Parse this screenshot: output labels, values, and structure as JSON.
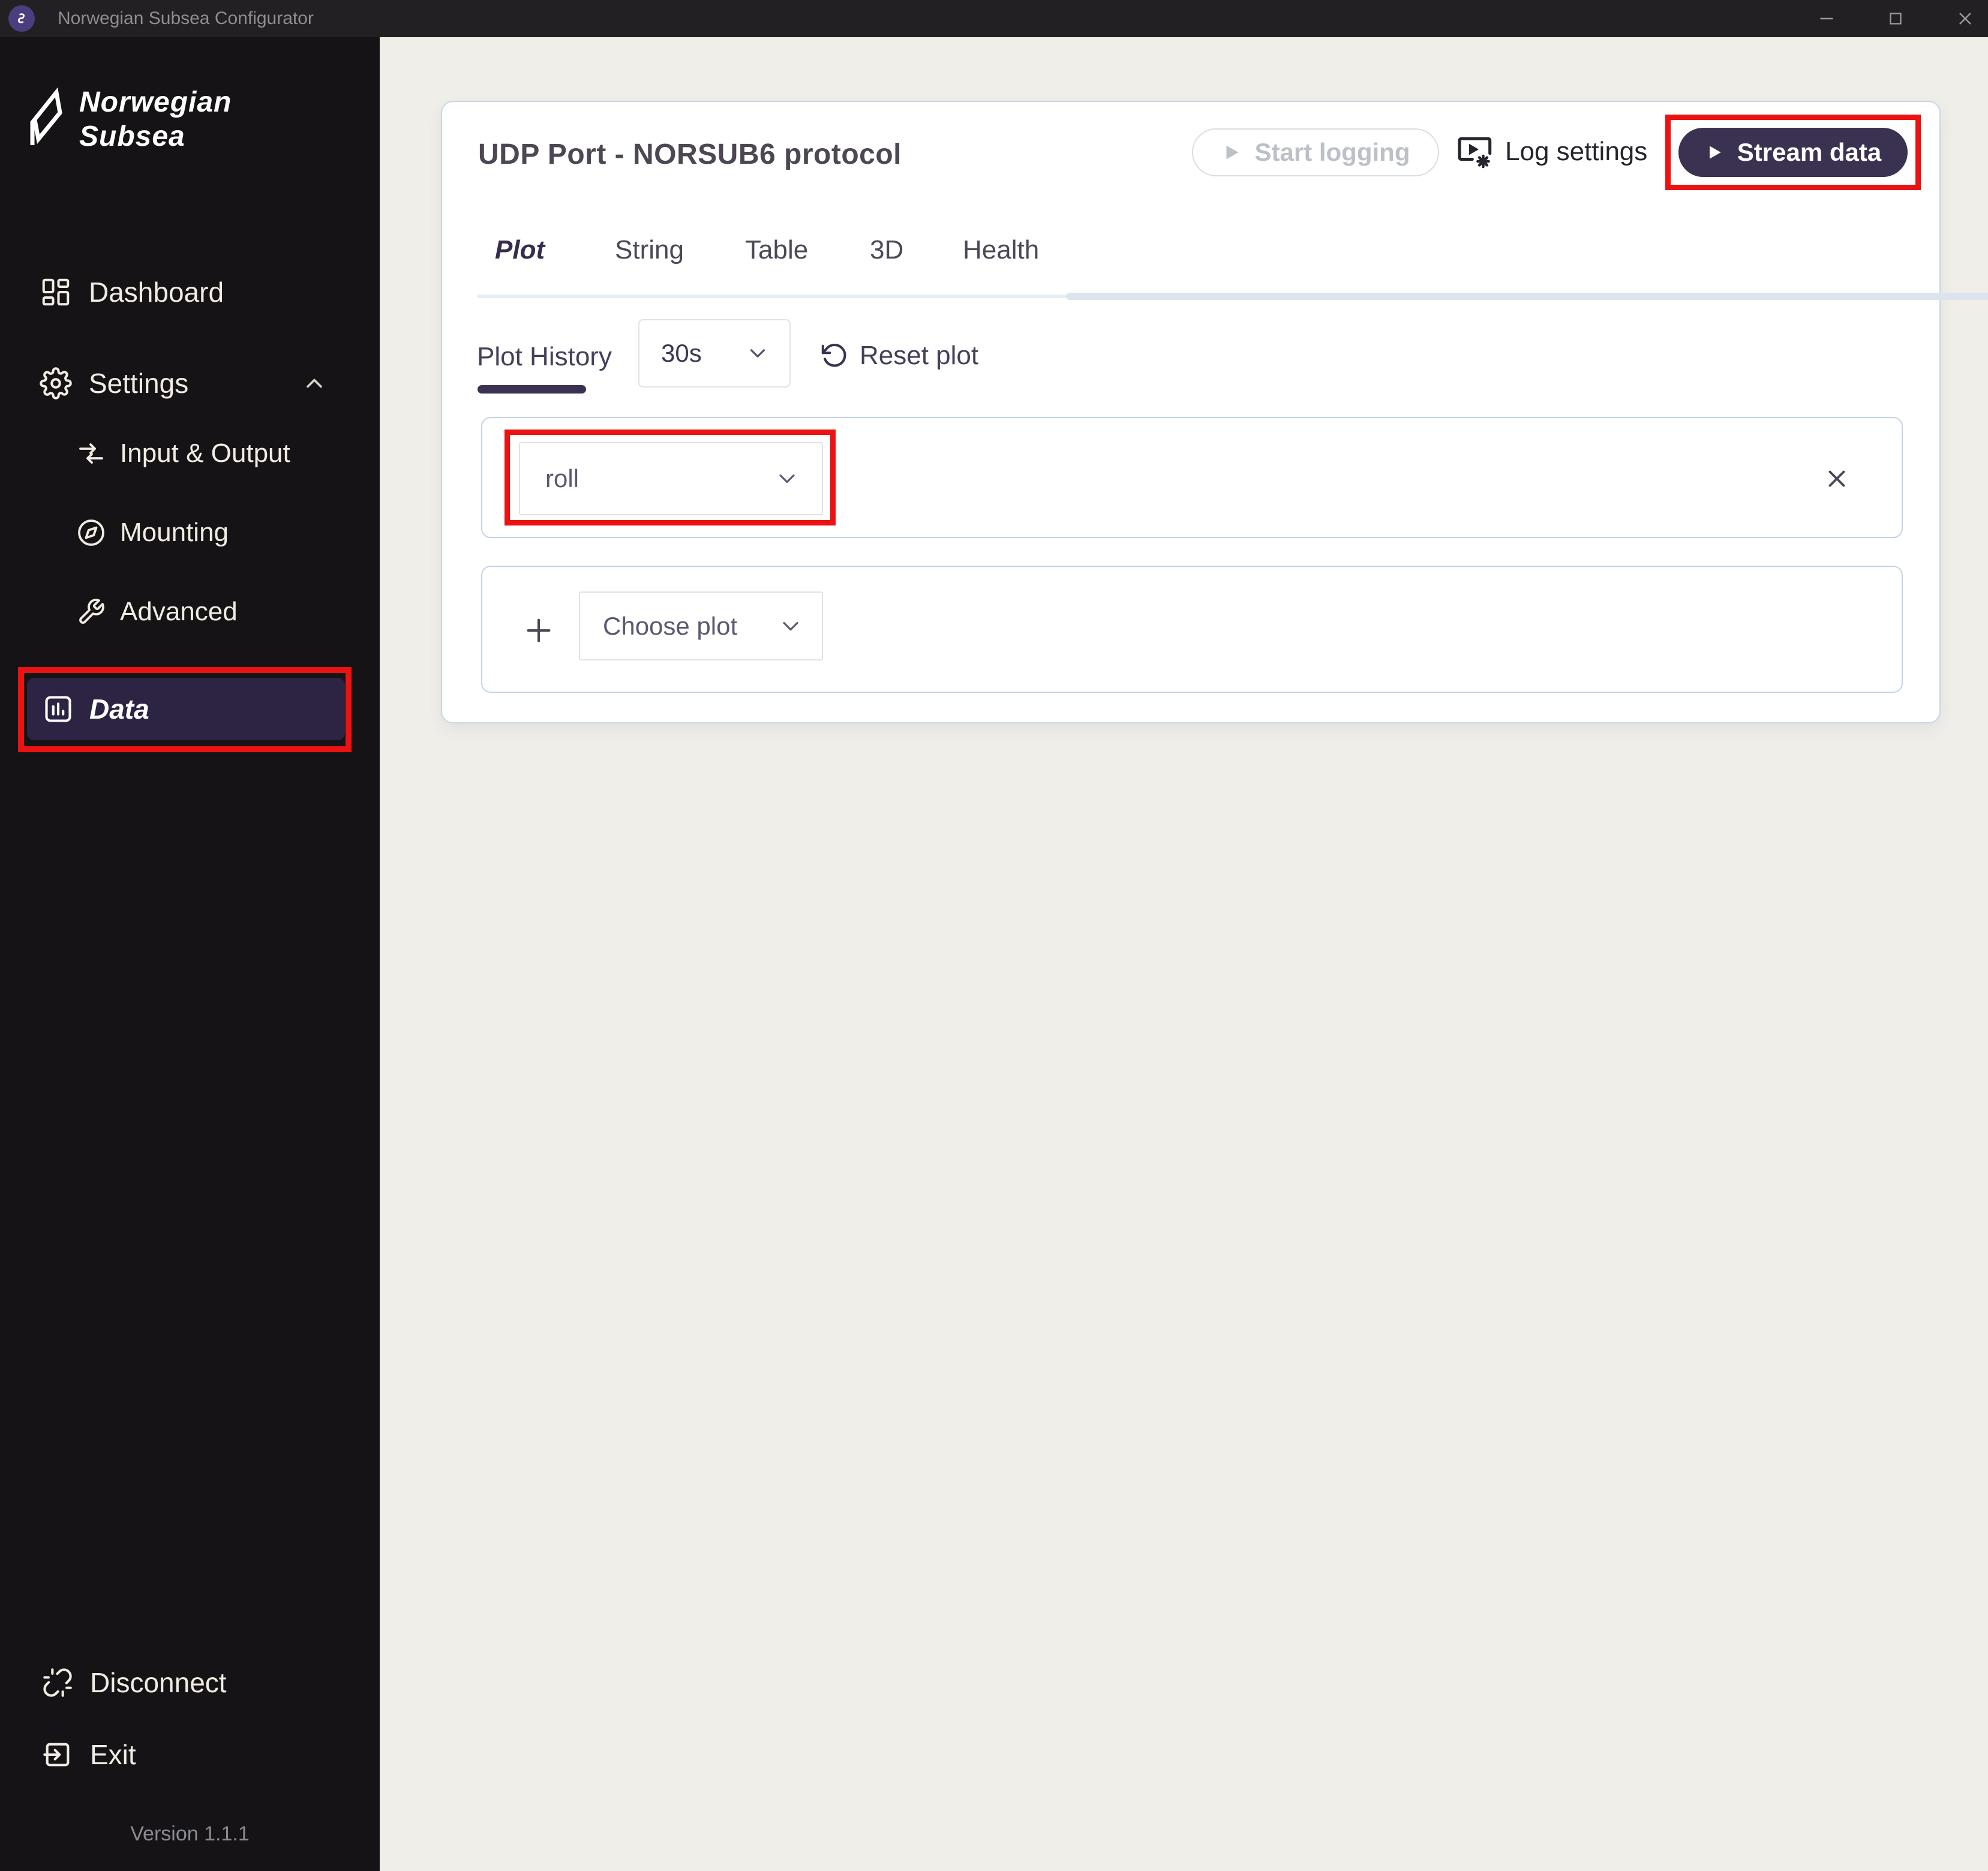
{
  "window": {
    "title": "Norwegian Subsea Configurator"
  },
  "sidebar": {
    "logo": {
      "line1": "Norwegian",
      "line2": "Subsea"
    },
    "items": [
      {
        "label": "Dashboard"
      },
      {
        "label": "Settings",
        "expanded": true
      },
      {
        "label": "Input & Output"
      },
      {
        "label": "Mounting"
      },
      {
        "label": "Advanced"
      },
      {
        "label": "Data",
        "active": true,
        "annotated": true
      }
    ],
    "footer_items": [
      {
        "label": "Disconnect"
      },
      {
        "label": "Exit"
      }
    ],
    "version": "Version 1.1.1"
  },
  "main": {
    "title": "UDP Port - NORSUB6 protocol",
    "actions": {
      "start_logging": {
        "label": "Start logging",
        "enabled": false
      },
      "log_settings": {
        "label": "Log settings"
      },
      "stream_data": {
        "label": "Stream data",
        "annotated": true
      }
    },
    "tabs": [
      {
        "label": "Plot",
        "active": true
      },
      {
        "label": "String"
      },
      {
        "label": "Table"
      },
      {
        "label": "3D"
      },
      {
        "label": "Health"
      }
    ],
    "plot_controls": {
      "history_label": "Plot History",
      "history_value": "30s",
      "reset_label": "Reset plot"
    },
    "plot_rows": [
      {
        "selected": "roll",
        "annotated": true
      }
    ],
    "add_plot": {
      "label": "Choose plot"
    }
  },
  "icons": {
    "app_badge": "norwegian-subsea-mark",
    "sidebar": [
      "dashboard-grid",
      "gear",
      "input-output-arrows",
      "compass",
      "wrench",
      "bar-chart"
    ],
    "footer": [
      "broken-link",
      "exit-arrow"
    ],
    "header": [
      "play",
      "screen-play-gear",
      "play"
    ],
    "controls": [
      "chevron-down",
      "reset-circular-arrow",
      "close-x",
      "plus"
    ],
    "window_controls": [
      "minimize",
      "maximize",
      "close"
    ]
  },
  "colors": {
    "accent": "#3b3252",
    "annotation": "#ea1212",
    "sidebar_active_bg": "#2d2343",
    "page_bg": "#f0eee9",
    "sidebar_bg": "#161316"
  }
}
